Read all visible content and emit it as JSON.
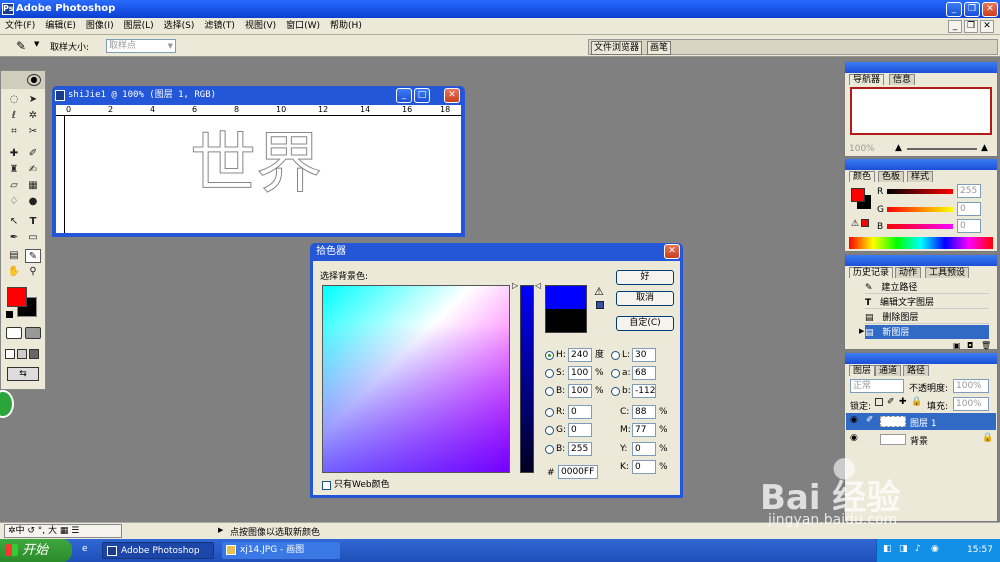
{
  "app": {
    "title": "Adobe Photoshop"
  },
  "menu": [
    "文件(F)",
    "编辑(E)",
    "图像(I)",
    "图层(L)",
    "选择(S)",
    "滤镜(T)",
    "视图(V)",
    "窗口(W)",
    "帮助(H)"
  ],
  "options": {
    "sample_size_label": "取样大小:",
    "sample_size_value": "取样点",
    "tab_file_browser": "文件浏览器",
    "tab_brushes": "画笔"
  },
  "document": {
    "title": "shiJie1 @ 100% (图层 1, RGB)",
    "text": "世界",
    "ruler_marks": [
      "0",
      "2",
      "4",
      "6",
      "8",
      "10",
      "12",
      "14",
      "16",
      "18"
    ]
  },
  "color_picker": {
    "title": "拾色器",
    "prompt": "选择背景色:",
    "ok": "好",
    "cancel": "取消",
    "custom": "自定(C)",
    "web_only": "只有Web颜色",
    "hsb": [
      {
        "label": "H:",
        "value": "240",
        "unit": "度"
      },
      {
        "label": "S:",
        "value": "100",
        "unit": "%"
      },
      {
        "label": "B:",
        "value": "100",
        "unit": "%"
      }
    ],
    "rgb": [
      {
        "label": "R:",
        "value": "0"
      },
      {
        "label": "G:",
        "value": "0"
      },
      {
        "label": "B:",
        "value": "255"
      }
    ],
    "lab": [
      {
        "label": "L:",
        "value": "30"
      },
      {
        "label": "a:",
        "value": "68"
      },
      {
        "label": "b:",
        "value": "-112"
      }
    ],
    "cmyk": [
      {
        "label": "C:",
        "value": "88",
        "unit": "%"
      },
      {
        "label": "M:",
        "value": "77",
        "unit": "%"
      },
      {
        "label": "Y:",
        "value": "0",
        "unit": "%"
      },
      {
        "label": "K:",
        "value": "0",
        "unit": "%"
      }
    ],
    "hex_label": "#",
    "hex": "0000FF",
    "new_color": "#0000ff",
    "old_color": "#000000"
  },
  "panels": {
    "navigator": {
      "tabs": [
        "导航器",
        "信息"
      ],
      "zoom": "100%"
    },
    "color": {
      "tabs": [
        "颜色",
        "色板",
        "样式"
      ],
      "r_label": "R",
      "g_label": "G",
      "b_label": "B",
      "r": "255",
      "g": "0",
      "b": "0"
    },
    "history": {
      "tabs": [
        "历史记录",
        "动作",
        "工具预设"
      ],
      "items": [
        "建立路径",
        "编辑文字图层",
        "删除图层",
        "新图层"
      ]
    },
    "layers": {
      "tabs": [
        "图层",
        "通道",
        "路径"
      ],
      "mode": "正常",
      "opacity_label": "不透明度:",
      "opacity": "100%",
      "lock_label": "锁定:",
      "fill_label": "填充:",
      "fill": "100%",
      "items": [
        "图层 1",
        "背景"
      ]
    }
  },
  "status": {
    "text": "点按图像以选取新颜色"
  },
  "taskbar": {
    "start": "开始",
    "items": [
      "Adobe Photoshop",
      "xj14.JPG - 画图"
    ],
    "time": "15:57"
  },
  "watermark": {
    "brand": "Bai 经验",
    "url": "jingyan.baidu.com"
  },
  "colors": {
    "foreground": "#ff0000",
    "background": "#000000",
    "xp_blue": "#2456d8"
  }
}
